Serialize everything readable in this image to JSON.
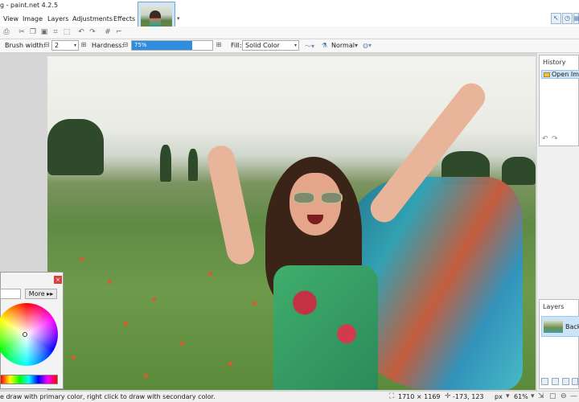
{
  "window": {
    "title": "g - paint.net 4.2.5"
  },
  "menu": {
    "items": [
      "View",
      "Image",
      "Layers",
      "Adjustments",
      "Effects"
    ]
  },
  "options": {
    "brush_width_label": "Brush width:",
    "brush_width_value": "2",
    "hardness_label": "Hardness:",
    "hardness_value": "75%",
    "hardness_fraction": 0.75,
    "fill_label": "Fill:",
    "fill_value": "Solid Color",
    "blend_value": "Normal"
  },
  "history": {
    "title": "History",
    "items": [
      "Open Image"
    ]
  },
  "layers": {
    "title": "Layers",
    "items": [
      "Backg"
    ]
  },
  "colors": {
    "more_label": "More ▸▸"
  },
  "status": {
    "hint": "e draw with primary color, right click to draw with secondary color.",
    "image_size": "1710 × 1169",
    "cursor_pos": "-173, 123",
    "unit": "px",
    "zoom": "61%"
  },
  "theme": {
    "accent": "#2f8de0",
    "selection": "#cce4f7"
  }
}
